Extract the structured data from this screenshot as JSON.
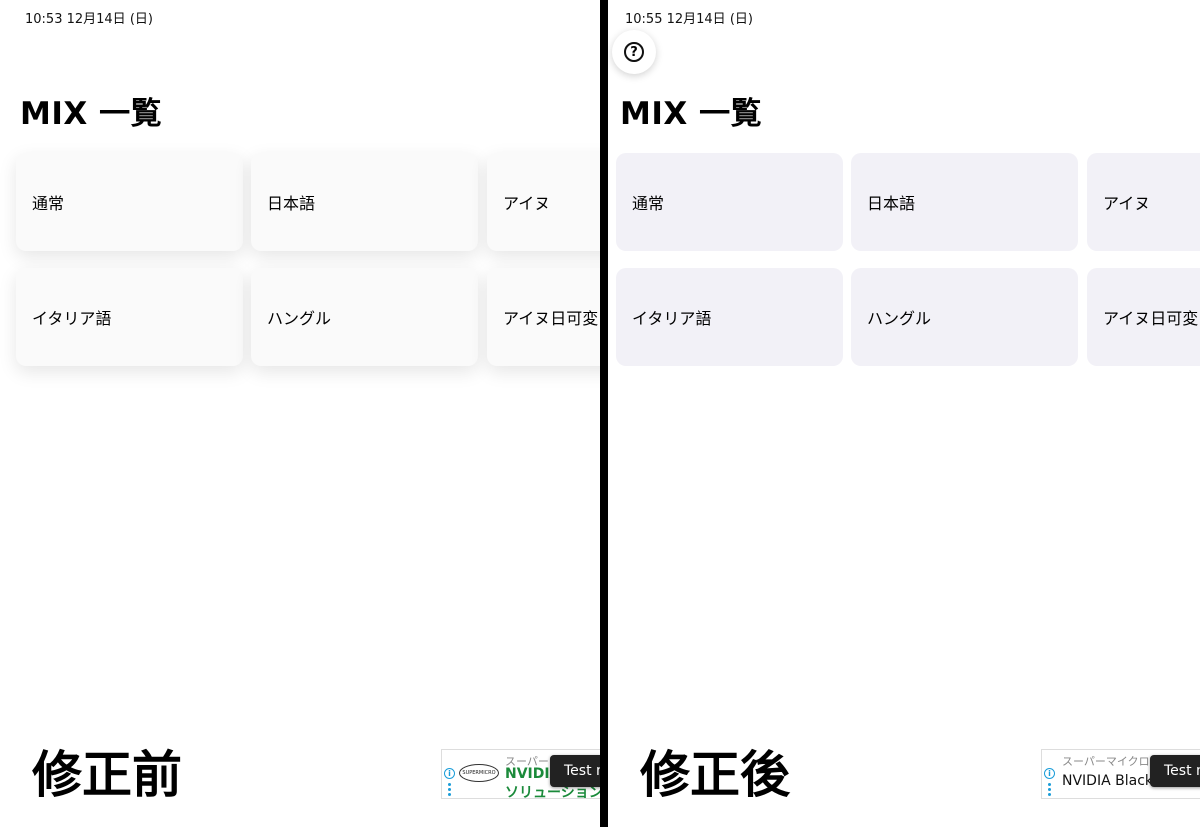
{
  "left": {
    "status": "10:53   12月14日 (日)",
    "title": "MIX 一覧",
    "cards": [
      "通常",
      "日本語",
      "アイヌ",
      "イタリア語",
      "ハングル",
      "アイヌ日可変"
    ],
    "caption": "修正前",
    "ad": {
      "small": "スーパーマ",
      "headline": "NVIDIA",
      "subline": "ソリューション",
      "logo": "SUPERMICRO",
      "test_badge": "Test m"
    }
  },
  "right": {
    "status": "10:55   12月14日 (日)",
    "help_icon": "?",
    "title": "MIX 一覧",
    "cards": [
      "通常",
      "日本語",
      "アイヌ",
      "イタリア語",
      "ハングル",
      "アイヌ日可変"
    ],
    "caption": "修正後",
    "ad": {
      "small": "スーパーマイクロ株",
      "headline": "NVIDIA Black",
      "test_badge": "Test m"
    }
  },
  "colors": {
    "card_before": "#fafafa",
    "card_after": "#f2f1f7",
    "ad_green": "#1a8a3a",
    "ad_info_blue": "#1a9dd9",
    "divider": "#000000"
  }
}
